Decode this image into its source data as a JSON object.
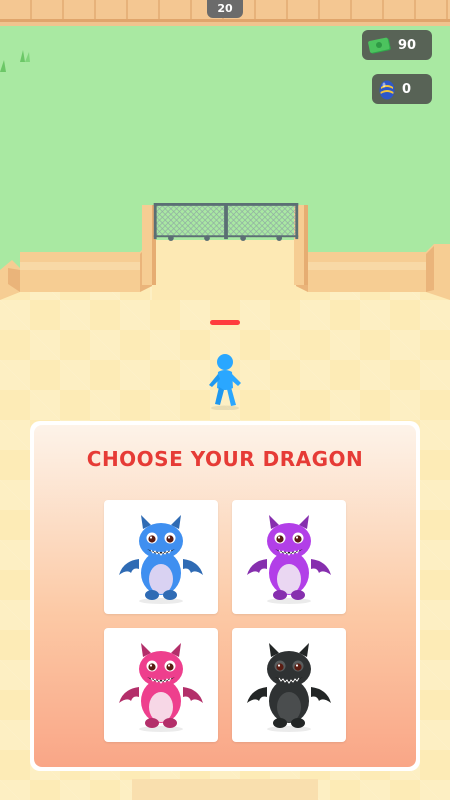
{
  "hud": {
    "level": "20",
    "money": "90",
    "eggs": "0",
    "money_icon": "cash-icon",
    "egg_icon": "dragon-egg-icon"
  },
  "dialog": {
    "title": "CHOOSE YOUR DRAGON",
    "title_color": "#e63b36",
    "options": [
      {
        "name": "blue-dragon",
        "color": "#3f8ff0",
        "belly": "#d9d2f2"
      },
      {
        "name": "purple-dragon",
        "color": "#b23fe8",
        "belly": "#ead7f2"
      },
      {
        "name": "pink-dragon",
        "color": "#ee3f8d",
        "belly": "#f7d7e6"
      },
      {
        "name": "black-dragon",
        "color": "#2f3233",
        "belly": "#4a4d4e"
      }
    ]
  },
  "player": {
    "color": "#2aa7ff"
  }
}
